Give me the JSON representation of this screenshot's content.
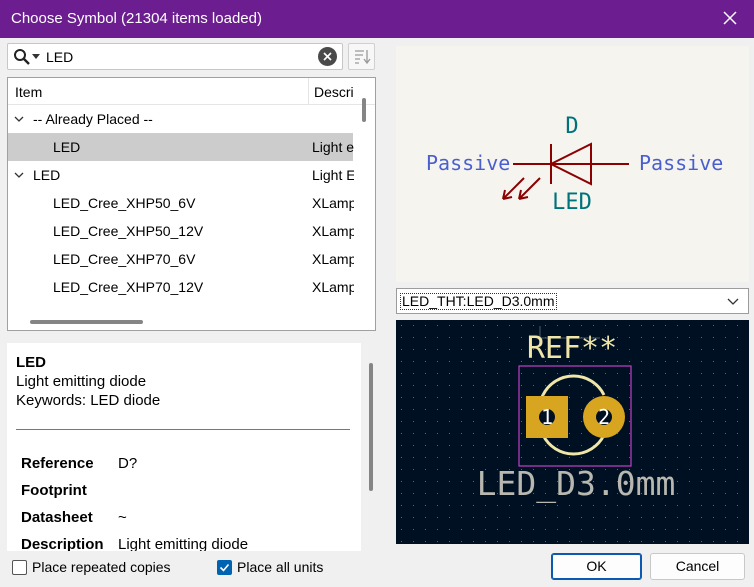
{
  "window": {
    "title": "Choose Symbol (21304 items loaded)"
  },
  "search": {
    "value": "LED",
    "placeholder": ""
  },
  "tree": {
    "columns": [
      "Item",
      "Description"
    ],
    "rows": [
      {
        "name": "-- Already Placed --",
        "desc": "",
        "level": 0,
        "expanded": true,
        "selected": false
      },
      {
        "name": "LED",
        "desc": "Light emitting diode",
        "level": 1,
        "expanded": false,
        "selected": true
      },
      {
        "name": "LED",
        "desc": "Light Emitting Diode",
        "level": 0,
        "expanded": true,
        "selected": false
      },
      {
        "name": "LED_Cree_XHP50_6V",
        "desc": "XLamp",
        "level": 1,
        "expanded": false,
        "selected": false
      },
      {
        "name": "LED_Cree_XHP50_12V",
        "desc": "XLamp",
        "level": 1,
        "expanded": false,
        "selected": false
      },
      {
        "name": "LED_Cree_XHP70_6V",
        "desc": "XLamp",
        "level": 1,
        "expanded": false,
        "selected": false
      },
      {
        "name": "LED_Cree_XHP70_12V",
        "desc": "XLamp",
        "level": 1,
        "expanded": false,
        "selected": false
      }
    ]
  },
  "details": {
    "name": "LED",
    "description": "Light emitting diode",
    "keywords": "Keywords: LED diode",
    "properties": [
      {
        "label": "Reference",
        "value": "D?"
      },
      {
        "label": "Footprint",
        "value": ""
      },
      {
        "label": "Datasheet",
        "value": "~"
      },
      {
        "label": "Description",
        "value": "Light emitting diode"
      }
    ]
  },
  "symbol_preview": {
    "ref": "D",
    "value": "LED",
    "pin_left": "Passive",
    "pin_right": "Passive",
    "line_color": "#8b0000",
    "pin_label_color": "#4a5fcf",
    "field_color": "#00727a"
  },
  "footprint": {
    "selected": "LED_THT:LED_D3.0mm",
    "ref": "REF**",
    "value": "LED_D3.0mm",
    "pad1": "1",
    "pad2": "2",
    "silk_color": "#f0e6a8",
    "pad_color": "#d8a521",
    "courtyard_color": "#c23fc4"
  },
  "options": {
    "repeated_label": "Place repeated copies",
    "repeated_checked": false,
    "all_units_label": "Place all units",
    "all_units_checked": true
  },
  "buttons": {
    "ok": "OK",
    "cancel": "Cancel"
  }
}
